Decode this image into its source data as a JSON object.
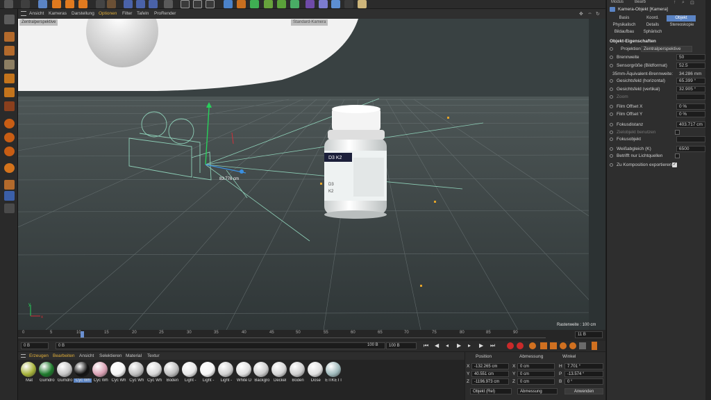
{
  "viewport_menu": [
    "Ansicht",
    "Kameras",
    "Darstellung",
    "Optionen",
    "Filter",
    "Tafeln",
    "ProRender"
  ],
  "viewport": {
    "camera_label": "Zentralperspektive",
    "camera_label2": "Standard-Kamera",
    "distance_label": "83.776 cm",
    "grid_label": "Rasterweite : 100 cm",
    "bottle_text": [
      "D3 K2",
      "D3",
      "K2"
    ]
  },
  "timeline": {
    "ticks": [
      "0",
      "5",
      "10",
      "15",
      "20",
      "25",
      "30",
      "35",
      "40",
      "45",
      "50",
      "55",
      "60",
      "65",
      "70",
      "75",
      "80",
      "85",
      "90"
    ],
    "end_frame": "11 B",
    "start_field": "0 B",
    "current_field": "0 B",
    "end_field": "100 B",
    "end_field2": "100 B"
  },
  "material_menu": [
    "Erzeugen",
    "Bearbeiten",
    "Ansicht",
    "Selektieren",
    "Material",
    "Textur"
  ],
  "materials": [
    {
      "label": "Mat",
      "color": "#a6b23a"
    },
    {
      "label": "Gumdro",
      "color": "#1e7a2c"
    },
    {
      "label": "Gumdro",
      "color": "#c4c4c4"
    },
    {
      "label": "Cyc Wh",
      "color": "#111111"
    },
    {
      "label": "Cyc Wh",
      "color": "#d9a0b3"
    },
    {
      "label": "Cyc Wh",
      "color": "#f4f4f4"
    },
    {
      "label": "Cyc Wh",
      "color": "#bdbdbd"
    },
    {
      "label": "Cyc Wh",
      "color": "#d6d6d6"
    },
    {
      "label": "Boden",
      "color": "#bdbdbd"
    },
    {
      "label": "Light -",
      "color": "#e6e6e6"
    },
    {
      "label": "Light -",
      "color": "#f6f6f6"
    },
    {
      "label": "Light -",
      "color": "#cfcfcf"
    },
    {
      "label": "White D",
      "color": "#dedede"
    },
    {
      "label": "Backgro",
      "color": "#cbcbcb"
    },
    {
      "label": "Deckel",
      "color": "#d4d4d4"
    },
    {
      "label": "Boden",
      "color": "#cfcfcf"
    },
    {
      "label": "Dose",
      "color": "#e0e0e0"
    },
    {
      "label": "ETIKETT",
      "color": "#9fb9bb"
    }
  ],
  "coords": {
    "headers": [
      "Position",
      "Abmessung",
      "Winkel"
    ],
    "x": "-132.265 cm",
    "y": "40.551 cm",
    "z": "-1196.973 cm",
    "sx": "0 cm",
    "sy": "0 cm",
    "sz": "0 cm",
    "h": "7.701 °",
    "p": "-13.574 °",
    "b": "0 °",
    "mode": "Objekt (Rel)",
    "size_mode": "Abmessung",
    "apply": "Anwenden"
  },
  "attributes": {
    "top": [
      "Modus",
      "Bearb"
    ],
    "title": "Kamera-Objekt [Kamera]",
    "tabs": [
      "Basis",
      "Koord.",
      "Objekt",
      "Physikalisch",
      "Details",
      "Stereoskopie",
      "Bildaufbau",
      "Sphärisch"
    ],
    "section": "Objekt-Eigenschaften",
    "projection_label": "Projektion",
    "projection_value": "Zentralperspektive",
    "props": [
      {
        "label": "Brennweite",
        "value": "50"
      },
      {
        "label": "Sensorgröße (Bildformat)",
        "value": "52.5"
      },
      {
        "label": "35mm-Äquivalent-Brennweite:",
        "value": "34.286 mm"
      },
      {
        "label": "Gesichtsfeld (horizontal)",
        "value": "65.399 °"
      },
      {
        "label": "Gesichtsfeld (vertikal)",
        "value": "32.905 °"
      },
      {
        "label": "Zoom",
        "value": ""
      },
      {
        "label": "Film Offset X",
        "value": "0 %"
      },
      {
        "label": "Film Offset Y",
        "value": "0 %"
      },
      {
        "label": "Fokusdistanz",
        "value": "403.717 cm"
      },
      {
        "label": "Zielobjekt benutzen",
        "value": ""
      },
      {
        "label": "Fokusobjekt",
        "value": ""
      },
      {
        "label": "Weißabgleich (K)",
        "value": "6500"
      },
      {
        "label": "Betrifft nur Lichtquellen",
        "value": ""
      },
      {
        "label": "Zu Komposition exportieren",
        "value": ""
      }
    ]
  }
}
